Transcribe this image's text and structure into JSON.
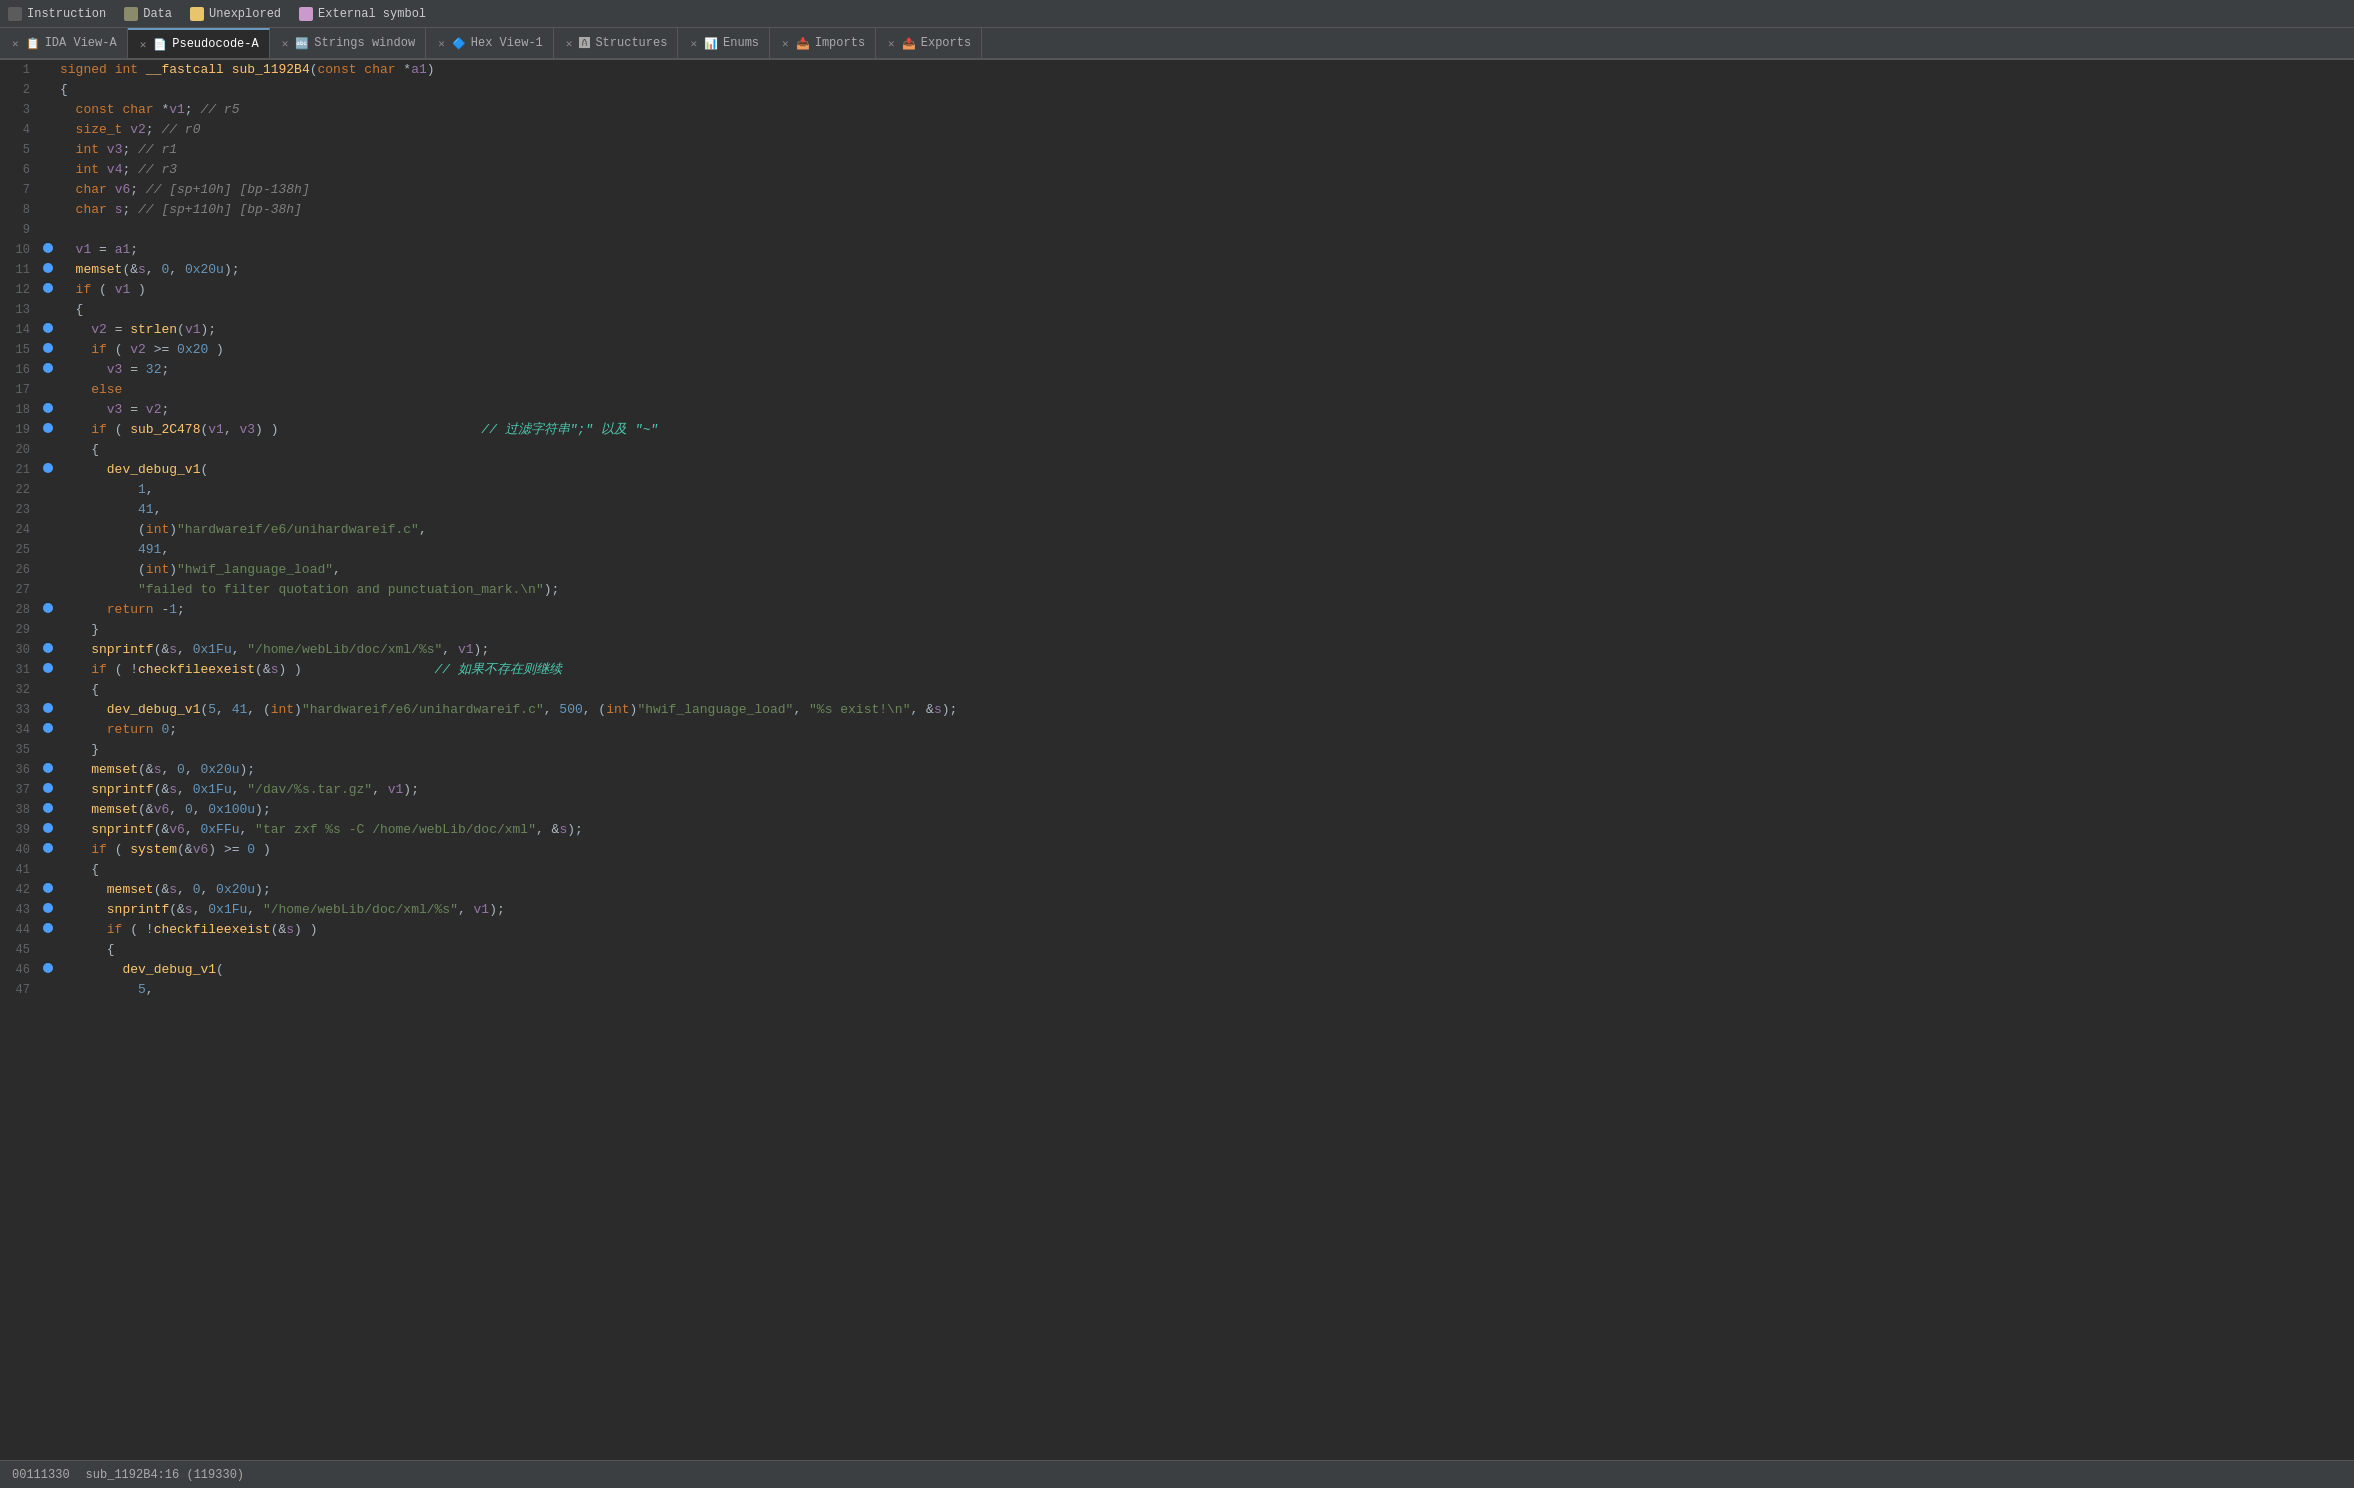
{
  "legend": {
    "items": [
      {
        "label": "Instruction",
        "color": "#5b5b5b"
      },
      {
        "label": "Data",
        "color": "#8b8b6b"
      },
      {
        "label": "Unexplored",
        "color": "#e8c46a"
      },
      {
        "label": "External symbol",
        "color": "#cc99cc"
      }
    ]
  },
  "tabs": [
    {
      "id": "ida-view-a",
      "label": "IDA View-A",
      "icon": "📋",
      "active": false,
      "closeable": true
    },
    {
      "id": "pseudocode-a",
      "label": "Pseudocode-A",
      "icon": "📄",
      "active": true,
      "closeable": true
    },
    {
      "id": "strings-window",
      "label": "Strings window",
      "icon": "🔤",
      "active": false,
      "closeable": true
    },
    {
      "id": "hex-view-1",
      "label": "Hex View-1",
      "icon": "🔷",
      "active": false,
      "closeable": true
    },
    {
      "id": "structures",
      "label": "Structures",
      "icon": "🅰",
      "active": false,
      "closeable": true
    },
    {
      "id": "enums",
      "label": "Enums",
      "icon": "📊",
      "active": false,
      "closeable": true
    },
    {
      "id": "imports",
      "label": "Imports",
      "icon": "📥",
      "active": false,
      "closeable": true
    },
    {
      "id": "exports",
      "label": "Exports",
      "icon": "📤",
      "active": false,
      "closeable": true
    }
  ],
  "code_header": "signed int __fastcall sub_1192B4(const char *a1)",
  "status_bar": {
    "address": "00111330",
    "info": "sub_1192B4:16 (119330)"
  }
}
